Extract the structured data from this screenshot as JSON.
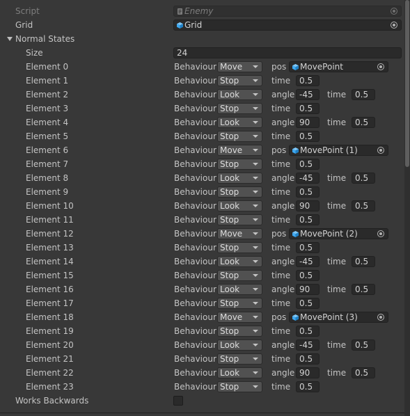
{
  "script": {
    "label": "Script",
    "value": "Enemy",
    "icon": "script-file-icon"
  },
  "grid": {
    "label": "Grid",
    "value": "Grid",
    "icon": "prefab-cube-icon"
  },
  "normal_states": {
    "label": "Normal States",
    "size_label": "Size",
    "size_value": "24",
    "behaviour_label": "Behaviour",
    "elements": [
      {
        "label": "Element 0",
        "behaviour": "Move",
        "param1_label": "pos",
        "pos": "MovePoint"
      },
      {
        "label": "Element 1",
        "behaviour": "Stop",
        "param1_label": "time",
        "time": "0.5"
      },
      {
        "label": "Element 2",
        "behaviour": "Look",
        "param1_label": "angle",
        "angle": "-45",
        "param2_label": "time",
        "time": "0.5"
      },
      {
        "label": "Element 3",
        "behaviour": "Stop",
        "param1_label": "time",
        "time": "0.5"
      },
      {
        "label": "Element 4",
        "behaviour": "Look",
        "param1_label": "angle",
        "angle": "90",
        "param2_label": "time",
        "time": "0.5"
      },
      {
        "label": "Element 5",
        "behaviour": "Stop",
        "param1_label": "time",
        "time": "0.5"
      },
      {
        "label": "Element 6",
        "behaviour": "Move",
        "param1_label": "pos",
        "pos": "MovePoint (1)"
      },
      {
        "label": "Element 7",
        "behaviour": "Stop",
        "param1_label": "time",
        "time": "0.5"
      },
      {
        "label": "Element 8",
        "behaviour": "Look",
        "param1_label": "angle",
        "angle": "-45",
        "param2_label": "time",
        "time": "0.5"
      },
      {
        "label": "Element 9",
        "behaviour": "Stop",
        "param1_label": "time",
        "time": "0.5"
      },
      {
        "label": "Element 10",
        "behaviour": "Look",
        "param1_label": "angle",
        "angle": "90",
        "param2_label": "time",
        "time": "0.5"
      },
      {
        "label": "Element 11",
        "behaviour": "Stop",
        "param1_label": "time",
        "time": "0.5"
      },
      {
        "label": "Element 12",
        "behaviour": "Move",
        "param1_label": "pos",
        "pos": "MovePoint (2)"
      },
      {
        "label": "Element 13",
        "behaviour": "Stop",
        "param1_label": "time",
        "time": "0.5"
      },
      {
        "label": "Element 14",
        "behaviour": "Look",
        "param1_label": "angle",
        "angle": "-45",
        "param2_label": "time",
        "time": "0.5"
      },
      {
        "label": "Element 15",
        "behaviour": "Stop",
        "param1_label": "time",
        "time": "0.5"
      },
      {
        "label": "Element 16",
        "behaviour": "Look",
        "param1_label": "angle",
        "angle": "90",
        "param2_label": "time",
        "time": "0.5"
      },
      {
        "label": "Element 17",
        "behaviour": "Stop",
        "param1_label": "time",
        "time": "0.5"
      },
      {
        "label": "Element 18",
        "behaviour": "Move",
        "param1_label": "pos",
        "pos": "MovePoint (3)"
      },
      {
        "label": "Element 19",
        "behaviour": "Stop",
        "param1_label": "time",
        "time": "0.5"
      },
      {
        "label": "Element 20",
        "behaviour": "Look",
        "param1_label": "angle",
        "angle": "-45",
        "param2_label": "time",
        "time": "0.5"
      },
      {
        "label": "Element 21",
        "behaviour": "Stop",
        "param1_label": "time",
        "time": "0.5"
      },
      {
        "label": "Element 22",
        "behaviour": "Look",
        "param1_label": "angle",
        "angle": "90",
        "param2_label": "time",
        "time": "0.5"
      },
      {
        "label": "Element 23",
        "behaviour": "Stop",
        "param1_label": "time",
        "time": "0.5"
      }
    ]
  },
  "works_backwards": {
    "label": "Works Backwards",
    "checked": false
  },
  "colors": {
    "background": "#383838",
    "field": "#2a2a2a",
    "dropdown": "#515151",
    "text": "#c4c4c4",
    "cube_icon": "#3ea8f0"
  }
}
